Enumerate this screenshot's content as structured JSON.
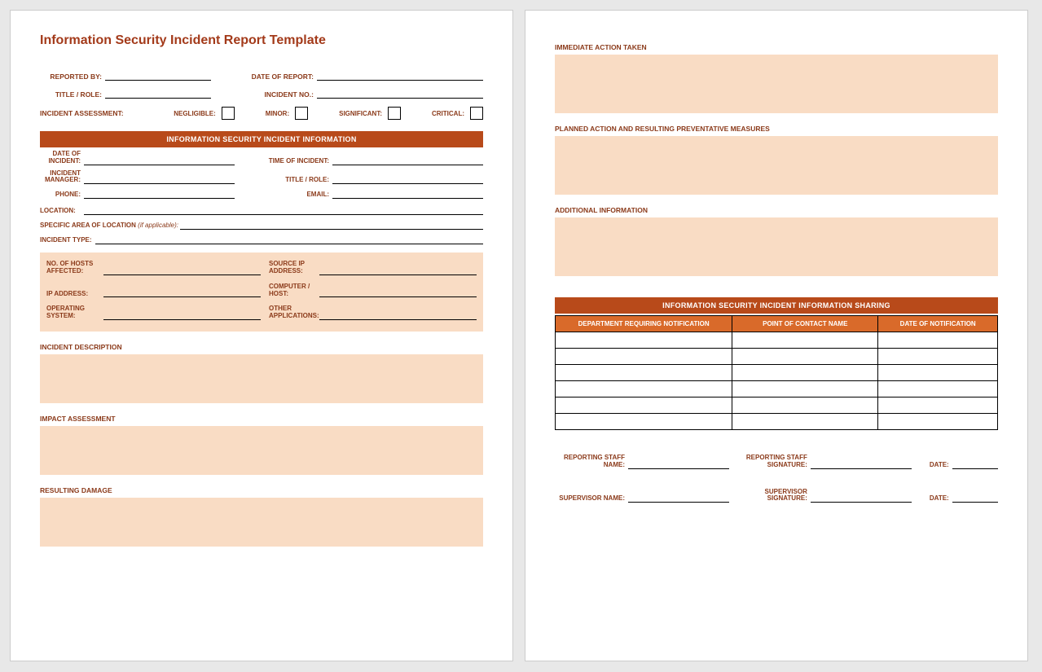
{
  "title": "Information Security Incident Report Template",
  "header_fields": {
    "reported_by": "REPORTED BY:",
    "date_of_report": "DATE OF REPORT:",
    "title_role": "TITLE / ROLE:",
    "incident_no": "INCIDENT NO.:"
  },
  "assessment": {
    "label": "INCIDENT ASSESSMENT:",
    "options": [
      "NEGLIGIBLE:",
      "MINOR:",
      "SIGNIFICANT:",
      "CRITICAL:"
    ]
  },
  "section1": {
    "header": "INFORMATION SECURITY INCIDENT INFORMATION",
    "date_of_incident": "DATE OF INCIDENT:",
    "time_of_incident": "TIME OF INCIDENT:",
    "incident_manager": "INCIDENT MANAGER:",
    "title_role": "TITLE / ROLE:",
    "phone": "PHONE:",
    "email": "EMAIL:",
    "location": "LOCATION:",
    "specific_area": "SPECIFIC AREA OF LOCATION",
    "specific_area_suffix": "(if applicable):",
    "incident_type": "INCIDENT TYPE:"
  },
  "peach": {
    "hosts": "NO. OF HOSTS AFFECTED:",
    "source_ip": "SOURCE IP ADDRESS:",
    "ip": "IP ADDRESS:",
    "computer": "COMPUTER / HOST:",
    "os": "OPERATING SYSTEM:",
    "other_apps": "OTHER APPLICATIONS:"
  },
  "blocks": {
    "incident_desc": "INCIDENT DESCRIPTION",
    "impact": "IMPACT ASSESSMENT",
    "damage": "RESULTING DAMAGE",
    "immediate": "IMMEDIATE ACTION TAKEN",
    "planned": "PLANNED ACTION AND RESULTING PREVENTATIVE MEASURES",
    "additional": "ADDITIONAL INFORMATION"
  },
  "sharing": {
    "header": "INFORMATION SECURITY INCIDENT INFORMATION SHARING",
    "cols": [
      "DEPARTMENT REQUIRING NOTIFICATION",
      "POINT OF CONTACT NAME",
      "DATE OF NOTIFICATION"
    ]
  },
  "sign": {
    "staff_name": "REPORTING STAFF NAME:",
    "staff_sig": "REPORTING STAFF SIGNATURE:",
    "sup_name": "SUPERVISOR NAME:",
    "sup_sig": "SUPERVISOR SIGNATURE:",
    "date": "DATE:"
  }
}
